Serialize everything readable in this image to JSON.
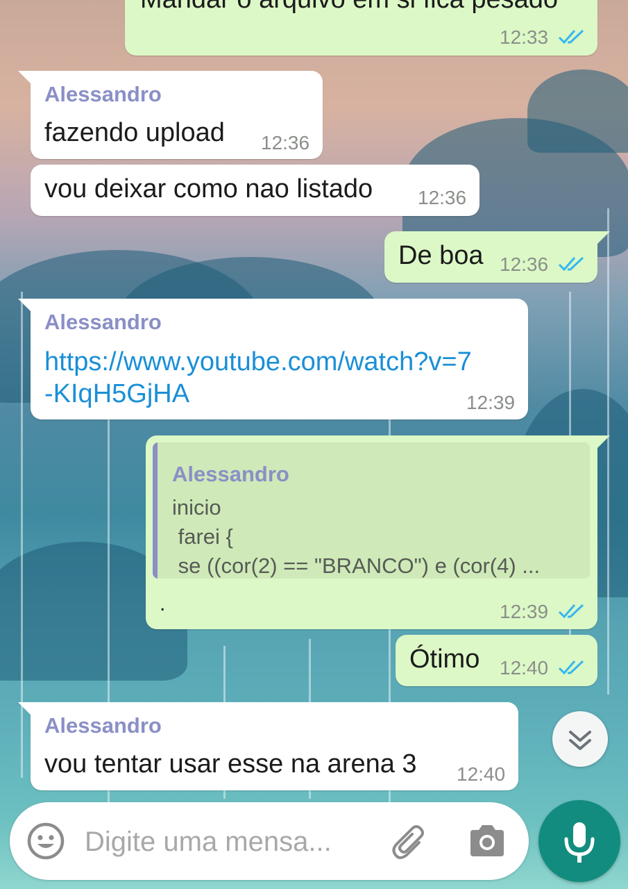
{
  "colors": {
    "outgoing_bubble": "#dcf8c6",
    "incoming_bubble": "#ffffff",
    "sender_name": "#8a8fc6",
    "link": "#1a8fd6",
    "read_ticks": "#34b7f1",
    "mic_button": "#128c7e"
  },
  "messages": [
    {
      "direction": "out",
      "text": "Mandar o arquivo em si fica pesado",
      "time": "12:33",
      "status": "read"
    },
    {
      "direction": "in",
      "sender": "Alessandro",
      "text": "fazendo upload",
      "time": "12:36"
    },
    {
      "direction": "in",
      "text": "vou deixar como nao listado",
      "time": "12:36"
    },
    {
      "direction": "out",
      "text": "De boa",
      "time": "12:36",
      "status": "read"
    },
    {
      "direction": "in",
      "sender": "Alessandro",
      "link_line1": "https://www.youtube.com/watch?v=7",
      "link_line2": "-KIqH5GjHA",
      "time": "12:39"
    },
    {
      "direction": "out",
      "quote": {
        "sender": "Alessandro",
        "line1": "inicio",
        "line2": " farei {",
        "line3": " se ((cor(2) == \"BRANCO\") e (cor(4) ..."
      },
      "text": ".",
      "time": "12:39",
      "status": "read"
    },
    {
      "direction": "out",
      "text": "Ótimo",
      "time": "12:40",
      "status": "read"
    },
    {
      "direction": "in",
      "sender": "Alessandro",
      "text": "vou tentar usar esse na arena 3",
      "time": "12:40"
    }
  ],
  "composer": {
    "placeholder": "Digite uma mensa...",
    "value": ""
  },
  "icons": {
    "emoji": "emoji-icon",
    "attach": "paperclip-icon",
    "camera": "camera-icon",
    "mic": "microphone-icon",
    "scroll_down": "chevron-double-down-icon",
    "read": "double-check-icon"
  }
}
